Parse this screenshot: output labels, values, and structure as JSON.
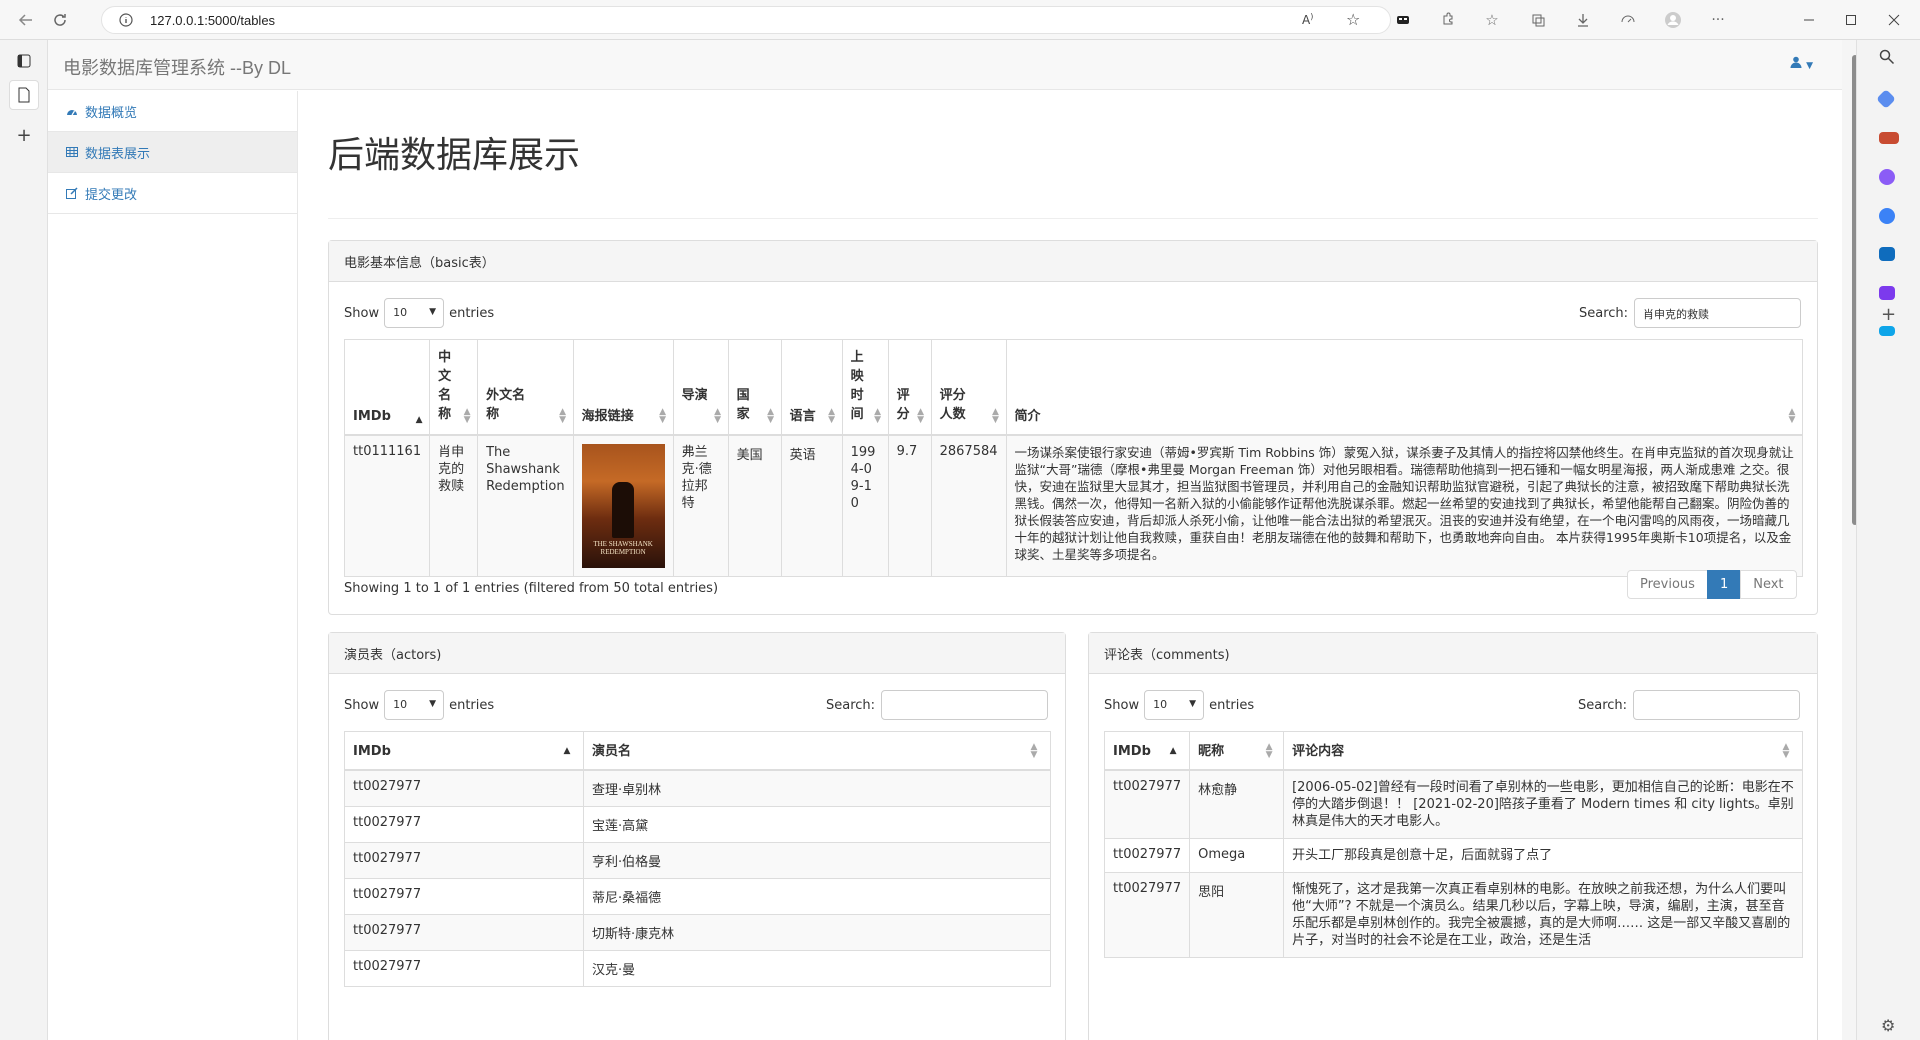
{
  "browser": {
    "url": "127.0.0.1:5000/tables"
  },
  "navbar": {
    "brand": "电影数据库管理系统 --By DL"
  },
  "sidebar": {
    "items": [
      {
        "label": "数据概览",
        "icon": "dashboard-icon"
      },
      {
        "label": "数据表展示",
        "icon": "table-icon"
      },
      {
        "label": "提交更改",
        "icon": "edit-icon"
      }
    ]
  },
  "page_title": "后端数据库展示",
  "basic": {
    "heading": "电影基本信息（basic表）",
    "show": "Show",
    "entries": "entries",
    "length": "10",
    "search_label": "Search:",
    "search_value": "肖申克的救赎",
    "columns": [
      "IMDb",
      "中文名称",
      "外文名称",
      "海报链接",
      "导演",
      "国家",
      "语言",
      "上映时间",
      "评分",
      "评分人数",
      "简介"
    ],
    "row": {
      "imdb": "tt0111161",
      "cn": "肖申克的救赎",
      "en": "The Shawshank Redemption",
      "poster_text": "THE SHAWSHANK REDEMPTION",
      "director": "弗兰克·德拉邦特",
      "country": "美国",
      "language": "英语",
      "date": "1994-09-10",
      "rating": "9.7",
      "votes": "2867584",
      "summary": "一场谋杀案使银行家安迪（蒂姆•罗宾斯 Tim Robbins 饰）蒙冤入狱，谋杀妻子及其情人的指控将囚禁他终生。在肖申克监狱的首次现身就让监狱“大哥”瑞德（摩根•弗里曼 Morgan Freeman 饰）对他另眼相看。瑞德帮助他搞到一把石锤和一幅女明星海报，两人渐成患难 之交。很快，安迪在监狱里大显其才，担当监狱图书管理员，并利用自己的金融知识帮助监狱官避税，引起了典狱长的注意，被招致麾下帮助典狱长洗黑钱。偶然一次，他得知一名新入狱的小偷能够作证帮他洗脱谋杀罪。燃起一丝希望的安迪找到了典狱长，希望他能帮自己翻案。阴险伪善的狱长假装答应安迪，背后却派人杀死小偷，让他唯一能合法出狱的希望泯灭。沮丧的安迪并没有绝望，在一个电闪雷鸣的风雨夜，一场暗藏几十年的越狱计划让他自我救赎，重获自由！老朋友瑞德在他的鼓舞和帮助下，也勇敢地奔向自由。 本片获得1995年奥斯卡10项提名，以及金球奖、土星奖等多项提名。"
    },
    "info": "Showing 1 to 1 of 1 entries (filtered from 50 total entries)",
    "prev": "Previous",
    "page": "1",
    "next": "Next"
  },
  "actors": {
    "heading": "演员表（actors)",
    "show": "Show",
    "entries": "entries",
    "length": "10",
    "search_label": "Search:",
    "columns": [
      "IMDb",
      "演员名"
    ],
    "rows": [
      [
        "tt0027977",
        "查理·卓别林"
      ],
      [
        "tt0027977",
        "宝莲·高黛"
      ],
      [
        "tt0027977",
        "亨利·伯格曼"
      ],
      [
        "tt0027977",
        "蒂尼·桑福德"
      ],
      [
        "tt0027977",
        "切斯特·康克林"
      ],
      [
        "tt0027977",
        "汉克·曼"
      ]
    ]
  },
  "comments": {
    "heading": "评论表（comments)",
    "show": "Show",
    "entries": "entries",
    "length": "10",
    "search_label": "Search:",
    "columns": [
      "IMDb",
      "昵称",
      "评论内容"
    ],
    "rows": [
      [
        "tt0027977",
        "林愈静",
        "[2006-05-02]曾经有一段时间看了卓别林的一些电影，更加相信自己的论断：电影在不停的大踏步倒退！！ [2021-02-20]陪孩子重看了 Modern times 和 city lights。卓别林真是伟大的天才电影人。"
      ],
      [
        "tt0027977",
        "Omega",
        "开头工厂那段真是创意十足，后面就弱了点了"
      ],
      [
        "tt0027977",
        "思阳",
        "惭愧死了，这才是我第一次真正看卓别林的电影。在放映之前我还想，为什么人们要叫他“大师”? 不就是一个演员么。结果几秒以后，字幕上映，导演，编剧，主演，甚至音乐配乐都是卓别林创作的。我完全被震撼，真的是大师啊…… 这是一部又辛酸又喜剧的片子，对当时的社会不论是在工业，政治，还是生活"
      ]
    ]
  }
}
